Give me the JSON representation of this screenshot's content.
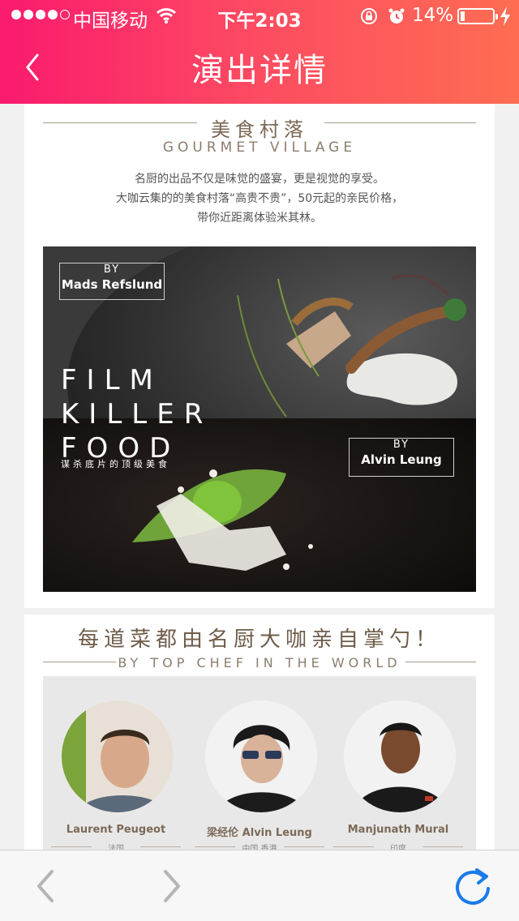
{
  "status_bar": {
    "carrier": "中国移动",
    "time": "下午2:03",
    "battery_percent": "14%",
    "battery_level": 0.14,
    "icons": [
      "signal-dots-icon",
      "wifi-icon",
      "rotation-lock-icon",
      "alarm-icon",
      "battery-icon",
      "charging-icon"
    ]
  },
  "header": {
    "title": "演出详情",
    "back_icon": "chevron-left-icon",
    "gradient": [
      "#fb1a6e",
      "#fe6d52"
    ]
  },
  "gourmet_section": {
    "title": "美食村落",
    "subtitle": "GOURMET VILLAGE",
    "description": [
      "名厨的出品不仅是味觉的盛宴，更是视觉的享受。",
      "大咖云集的的美食村落“高贵不贵”，50元起的亲民价格，",
      "带你近距离体验米其林。"
    ],
    "hero": {
      "by_top": {
        "by": "BY",
        "name": "Mads Refslund"
      },
      "film_lines": [
        "FILM",
        "KILLER",
        "FOOD"
      ],
      "film_cn": "谋杀底片的顶级美食",
      "by_bottom": {
        "by": "BY",
        "name": "Alvin Leung"
      }
    }
  },
  "chef_section": {
    "title": "每道菜都由名厨大咖亲自掌勺！",
    "subtitle": "BY TOP CHEF IN THE WORLD",
    "chefs": [
      {
        "name": "Laurent Peugeot",
        "country": "法国"
      },
      {
        "name": "梁经伦  Alvin Leung",
        "country": "中国 香港"
      },
      {
        "name": "Manjunath Mural",
        "country": "印度"
      }
    ]
  },
  "toolbar": {
    "back_icon": "chevron-left-icon",
    "forward_icon": "chevron-right-icon",
    "reload_icon": "reload-icon",
    "accent": "#1a7ae8"
  }
}
